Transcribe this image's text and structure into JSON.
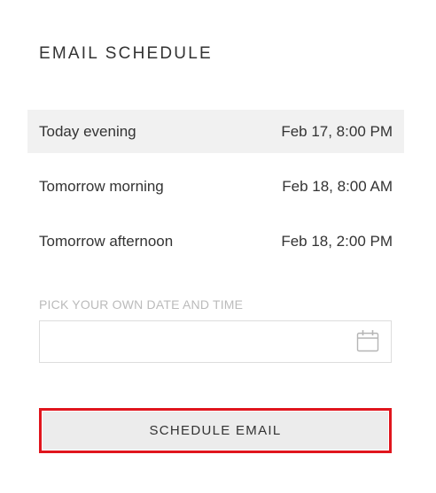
{
  "title": "EMAIL SCHEDULE",
  "options": [
    {
      "label": "Today evening",
      "time": "Feb 17, 8:00 PM",
      "selected": true
    },
    {
      "label": "Tomorrow morning",
      "time": "Feb 18, 8:00 AM",
      "selected": false
    },
    {
      "label": "Tomorrow afternoon",
      "time": "Feb 18, 2:00 PM",
      "selected": false
    }
  ],
  "custom": {
    "label": "PICK YOUR OWN DATE AND TIME",
    "value": "",
    "icon": "calendar-icon"
  },
  "schedule_button": {
    "label": "SCHEDULE EMAIL",
    "highlight_color": "#e0151d"
  },
  "colors": {
    "selected_bg": "#f1f1f1",
    "text": "#333333",
    "muted_label": "#bbbbbb"
  }
}
